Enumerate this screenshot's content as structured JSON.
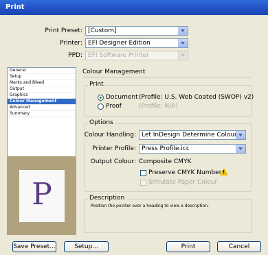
{
  "window": {
    "title": "Print"
  },
  "header": {
    "preset": {
      "label": "Print Preset:",
      "value": "[Custom]"
    },
    "printer": {
      "label": "Printer:",
      "value": "EFI Designer Edition"
    },
    "ppd": {
      "label": "PPD:",
      "value": "EFI Software Printer"
    }
  },
  "sidebar": {
    "items": [
      {
        "label": "General"
      },
      {
        "label": "Setup"
      },
      {
        "label": "Marks and Bleed"
      },
      {
        "label": "Output"
      },
      {
        "label": "Graphics"
      },
      {
        "label": "Colour Management",
        "selected": true
      },
      {
        "label": "Advanced"
      },
      {
        "label": "Summary"
      }
    ],
    "preview_letter": "P"
  },
  "main": {
    "section_title": "Colour Management",
    "print_group": {
      "title": "Print",
      "document": {
        "label": "Document",
        "info": "(Profile: U.S. Web Coated (SWOP) v2)",
        "selected": true
      },
      "proof": {
        "label": "Proof",
        "info": "(Profile: N/A)"
      }
    },
    "options_group": {
      "title": "Options",
      "colour_handling": {
        "label": "Colour Handling:",
        "value": "Let InDesign Determine Colours"
      },
      "printer_profile": {
        "label": "Printer Profile:",
        "value": "Press Profile.icc"
      },
      "output_colour": {
        "label": "Output Colour:",
        "value": "Composite CMYK"
      },
      "preserve_cmyk": {
        "label": "Preserve CMYK Numbers"
      },
      "simulate_paper": {
        "label": "Simulate Paper Colour"
      },
      "warning_icon": "warning-icon"
    },
    "description_group": {
      "title": "Description",
      "text": "Position the pointer over a heading to view a description."
    }
  },
  "footer": {
    "save_preset": "Save Preset...",
    "setup": "Setup...",
    "print": "Print",
    "cancel": "Cancel"
  },
  "colors": {
    "title_bar": "#1f4fc2",
    "selected_item": "#316ac5",
    "preview_bg": "#b0a27c",
    "preview_letter": "#5a3c83"
  }
}
